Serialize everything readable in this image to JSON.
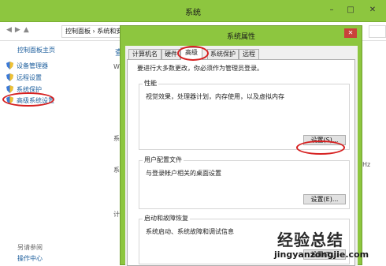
{
  "window": {
    "title": "系统",
    "controls": [
      "–",
      "□",
      "✕"
    ],
    "breadcrumb": "控制面板 › 系统和安全 › 系统"
  },
  "sidebar": {
    "home": "控制面板主页",
    "items": [
      {
        "label": "设备管理器",
        "icon": "shield-icon"
      },
      {
        "label": "远程设置",
        "icon": "shield-icon"
      },
      {
        "label": "系统保护",
        "icon": "shield-icon"
      },
      {
        "label": "高级系统设置",
        "icon": "shield-icon"
      }
    ],
    "see_also": "另请参阅",
    "action_center": "操作中心"
  },
  "background_fragments": [
    "查",
    "Wi",
    "系",
    "系",
    "计",
    "Hz"
  ],
  "dialog": {
    "title": "系统属性",
    "close": "✕",
    "tabs": [
      "计算机名",
      "硬件",
      "高级",
      "系统保护",
      "远程"
    ],
    "active_tab": "高级",
    "admin_note": "要进行大多数更改，你必须作为管理员登录。",
    "groups": [
      {
        "label": "性能",
        "desc": "视觉效果，处理器计划，内存使用，以及虚拟内存",
        "button": "设置(S)..."
      },
      {
        "label": "用户配置文件",
        "desc": "与登录帐户相关的桌面设置",
        "button": "设置(E)..."
      },
      {
        "label": "启动和故障恢复",
        "desc": "系统启动、系统故障和调试信息",
        "button": "设置(T)..."
      }
    ]
  },
  "watermark": {
    "cn": "经验总结",
    "url": "jingyanzongjie.com"
  },
  "colors": {
    "titlebar": "#8dc63f",
    "link": "#1c5e9c",
    "highlight_circle": "#d62020"
  }
}
